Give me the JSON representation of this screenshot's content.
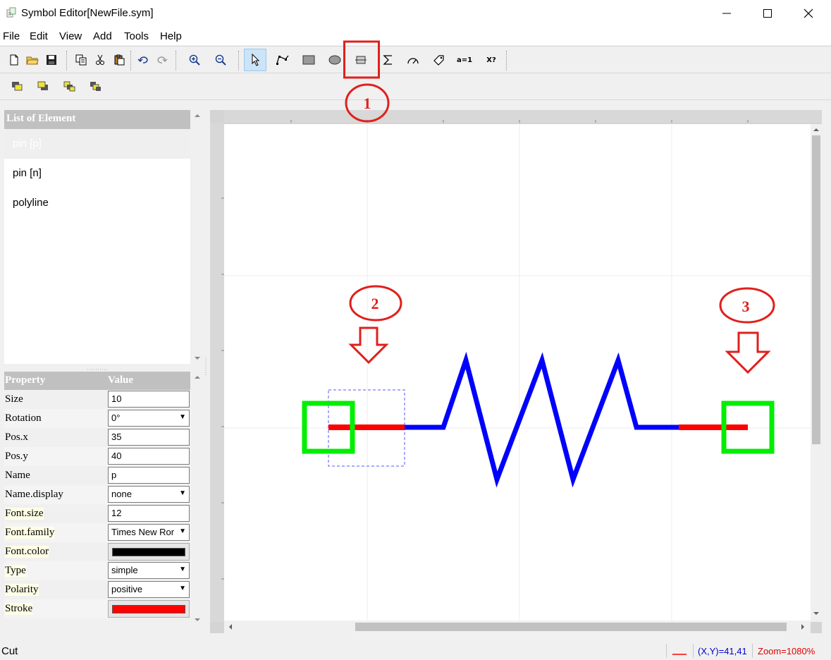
{
  "window": {
    "title": "Symbol Editor[NewFile.sym]"
  },
  "menu": [
    "File",
    "Edit",
    "View",
    "Add",
    "Tools",
    "Help"
  ],
  "toolbar": {
    "assign_label": "a=1",
    "query_label": "X?",
    "active_tool": "select-arrow"
  },
  "element_list": {
    "header": "List of Element",
    "items": [
      "pin [p]",
      "pin [n]",
      "polyline"
    ],
    "selected_index": 0
  },
  "properties": {
    "header_property": "Property",
    "header_value": "Value",
    "rows": [
      {
        "key": "Size",
        "value": "10"
      },
      {
        "key": "Rotation",
        "value": "0°"
      },
      {
        "key": "Pos.x",
        "value": "35"
      },
      {
        "key": "Pos.y",
        "value": "40"
      },
      {
        "key": "Name",
        "value": "p"
      },
      {
        "key": "Name.display",
        "value": "none"
      },
      {
        "key": "Font.size",
        "value": "12"
      },
      {
        "key": "Font.family",
        "value": "Times New Ror"
      },
      {
        "key": "Font.color",
        "color": "#000000"
      },
      {
        "key": "Type",
        "value": "simple"
      },
      {
        "key": "Polarity",
        "value": "positive"
      },
      {
        "key": "Stroke",
        "color": "#ff0000"
      }
    ]
  },
  "annotations": [
    "1",
    "2",
    "3"
  ],
  "status": {
    "left": "Cut",
    "coords": "(X,Y)=41,41",
    "zoom": "Zoom=1080%"
  },
  "colors": {
    "pin": "#ff0000",
    "polyline": "#0000ff",
    "pin_marker": "#00ee00",
    "annotation": "#e0201c",
    "selection": "#5555ff",
    "coords_text": "#0000cc",
    "zoom_text": "#e00000"
  }
}
